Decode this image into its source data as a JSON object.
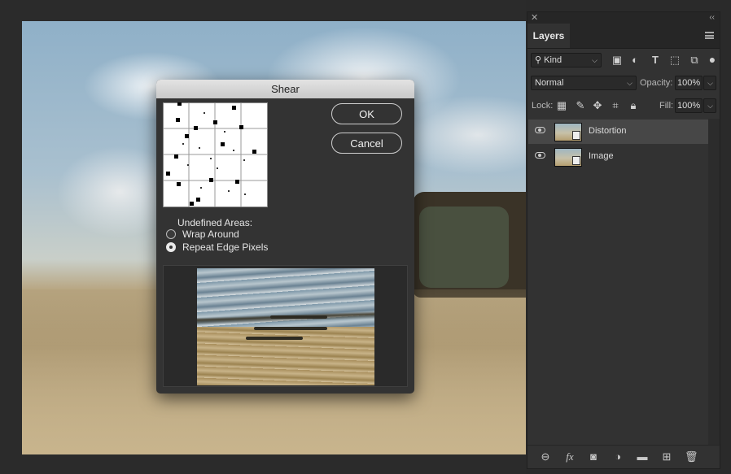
{
  "dialog": {
    "title": "Shear",
    "ok_label": "OK",
    "cancel_label": "Cancel",
    "undefined_areas_label": "Undefined Areas:",
    "options": [
      {
        "label": "Wrap Around",
        "selected": false
      },
      {
        "label": "Repeat Edge Pixels",
        "selected": true
      }
    ]
  },
  "layers_panel": {
    "tab_label": "Layers",
    "filter_kind": "Kind",
    "blend_mode": "Normal",
    "opacity_label": "Opacity:",
    "opacity_value": "100%",
    "lock_label": "Lock:",
    "fill_label": "Fill:",
    "fill_value": "100%",
    "layers": [
      {
        "name": "Distortion",
        "visible": true,
        "selected": true
      },
      {
        "name": "Image",
        "visible": true,
        "selected": false
      }
    ],
    "filter_icons": [
      "image-filter-icon",
      "adjustment-filter-icon",
      "type-filter-icon",
      "shape-filter-icon",
      "smart-object-filter-icon"
    ],
    "lock_icons": [
      "lock-transparent-icon",
      "lock-image-icon",
      "lock-position-icon",
      "lock-artboard-icon",
      "lock-all-icon"
    ],
    "bottom_icons": [
      "link-layers-icon",
      "fx-icon",
      "add-mask-icon",
      "adjustment-layer-icon",
      "group-folder-icon",
      "new-layer-icon",
      "delete-layer-icon"
    ],
    "fx_glyph": "fx"
  }
}
